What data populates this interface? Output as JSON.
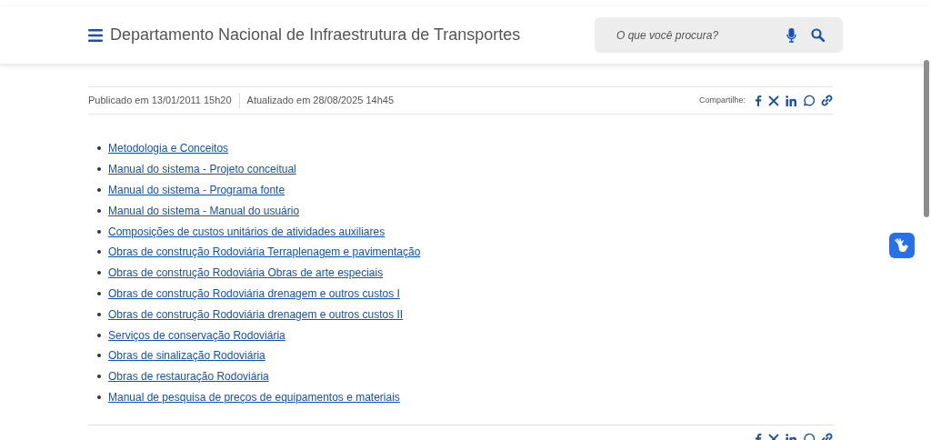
{
  "header": {
    "title": "Departamento Nacional de Infraestrutura de Transportes",
    "search": {
      "placeholder": "O que você procura?"
    }
  },
  "meta": {
    "published": "Publicado em 13/01/2011 15h20",
    "updated": "Atualizado em 28/08/2025 14h45",
    "share_label": "Compartilhe:"
  },
  "links": [
    "Metodologia e Conceitos",
    "Manual do sistema - Projeto conceitual",
    "Manual do sistema - Programa fonte",
    "Manual do sistema - Manual do usuário",
    "Composições de custos unitários de atividades auxiliares",
    "Obras de construção Rodoviária Terraplenagem e pavimentação",
    "Obras de construção Rodoviária Obras de arte especiais",
    "Obras de construção Rodoviária drenagem e outros custos I",
    "Obras de construção Rodoviária drenagem e outros custos II",
    "Serviços de conservação Rodoviária",
    "Obras de sinalização Rodoviária",
    "Obras de restauração Rodoviária",
    "Manual de pesquisa de preços de equipamentos e materiais"
  ]
}
